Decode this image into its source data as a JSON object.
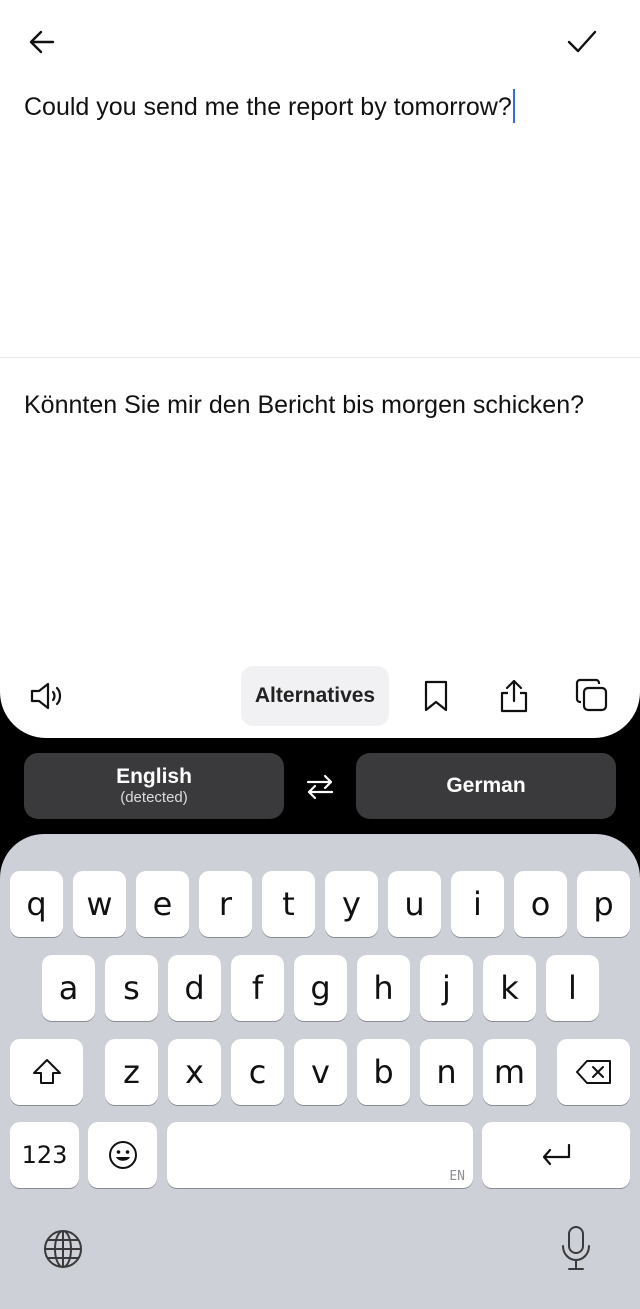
{
  "editor": {
    "source_text": "Could you send me the report by tomorrow?",
    "translated_text": "Könnten Sie mir den Bericht bis morgen schicken?"
  },
  "toolbar": {
    "alternatives_label": "Alternatives",
    "icons": [
      "speaker-icon",
      "bookmark-icon",
      "share-icon",
      "copy-icon"
    ]
  },
  "languages": {
    "source": "English",
    "source_note": "(detected)",
    "target": "German"
  },
  "keyboard": {
    "row1": [
      "q",
      "w",
      "e",
      "r",
      "t",
      "y",
      "u",
      "i",
      "o",
      "p"
    ],
    "row2": [
      "a",
      "s",
      "d",
      "f",
      "g",
      "h",
      "j",
      "k",
      "l"
    ],
    "row3": [
      "z",
      "x",
      "c",
      "v",
      "b",
      "n",
      "m"
    ],
    "numbers_label": "123",
    "space_hint": "EN"
  },
  "colors": {
    "caret": "#2f6ee6",
    "keyboard_bg": "#ced0d8",
    "pill_bg": "#3a3a3c"
  }
}
